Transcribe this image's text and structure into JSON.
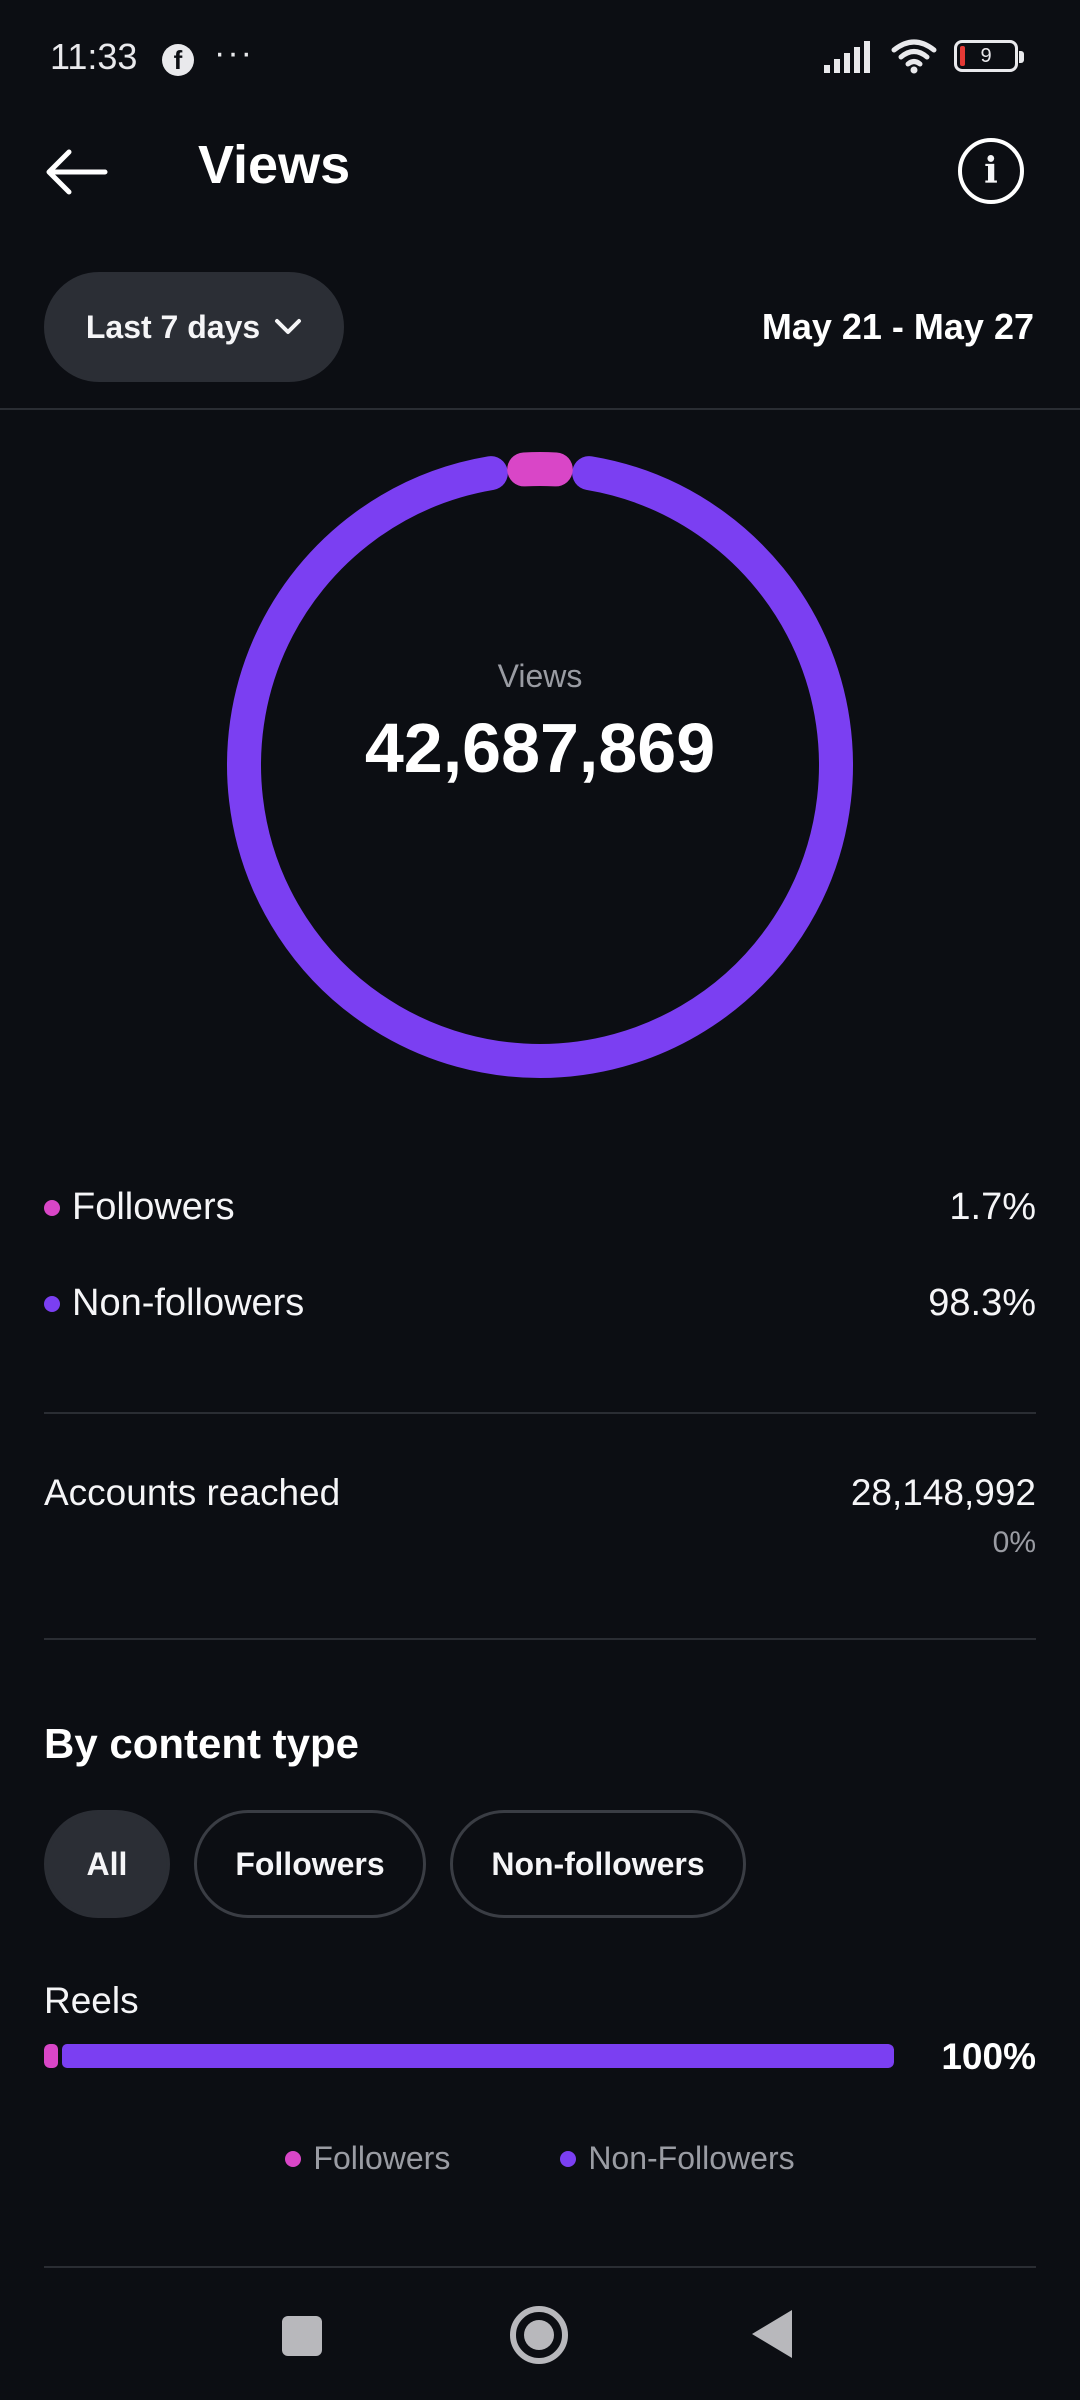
{
  "status_bar": {
    "time": "11:33",
    "more": "···",
    "battery_level": "9",
    "icons": [
      "facebook-icon",
      "signal-icon",
      "wifi-icon",
      "battery-icon"
    ]
  },
  "header": {
    "title": "Views",
    "back_icon": "arrow-left-icon",
    "info_icon": "info-icon"
  },
  "filter": {
    "range_label": "Last 7 days",
    "date_range": "May 21 - May 27"
  },
  "summary": {
    "label": "Views",
    "value": "42,687,869",
    "breakdown": [
      {
        "label": "Followers",
        "percent": "1.7%",
        "share": 0.017,
        "color": "#d946c7"
      },
      {
        "label": "Non-followers",
        "percent": "98.3%",
        "share": 0.983,
        "color": "#7b3ff2"
      }
    ]
  },
  "accounts_reached": {
    "label": "Accounts reached",
    "value": "28,148,992",
    "change": "0%"
  },
  "content_type": {
    "title": "By content type",
    "chips": [
      "All",
      "Followers",
      "Non-followers"
    ],
    "active_chip": "All",
    "rows": [
      {
        "label": "Reels",
        "percent": "100%",
        "followers_share": 0.017,
        "non_followers_share": 0.983
      }
    ],
    "legend": [
      {
        "label": "Followers",
        "color": "#d946c7"
      },
      {
        "label": "Non-Followers",
        "color": "#7b3ff2"
      }
    ]
  },
  "nav_bar": {
    "icons": [
      "recents-icon",
      "home-icon",
      "back-icon"
    ]
  }
}
